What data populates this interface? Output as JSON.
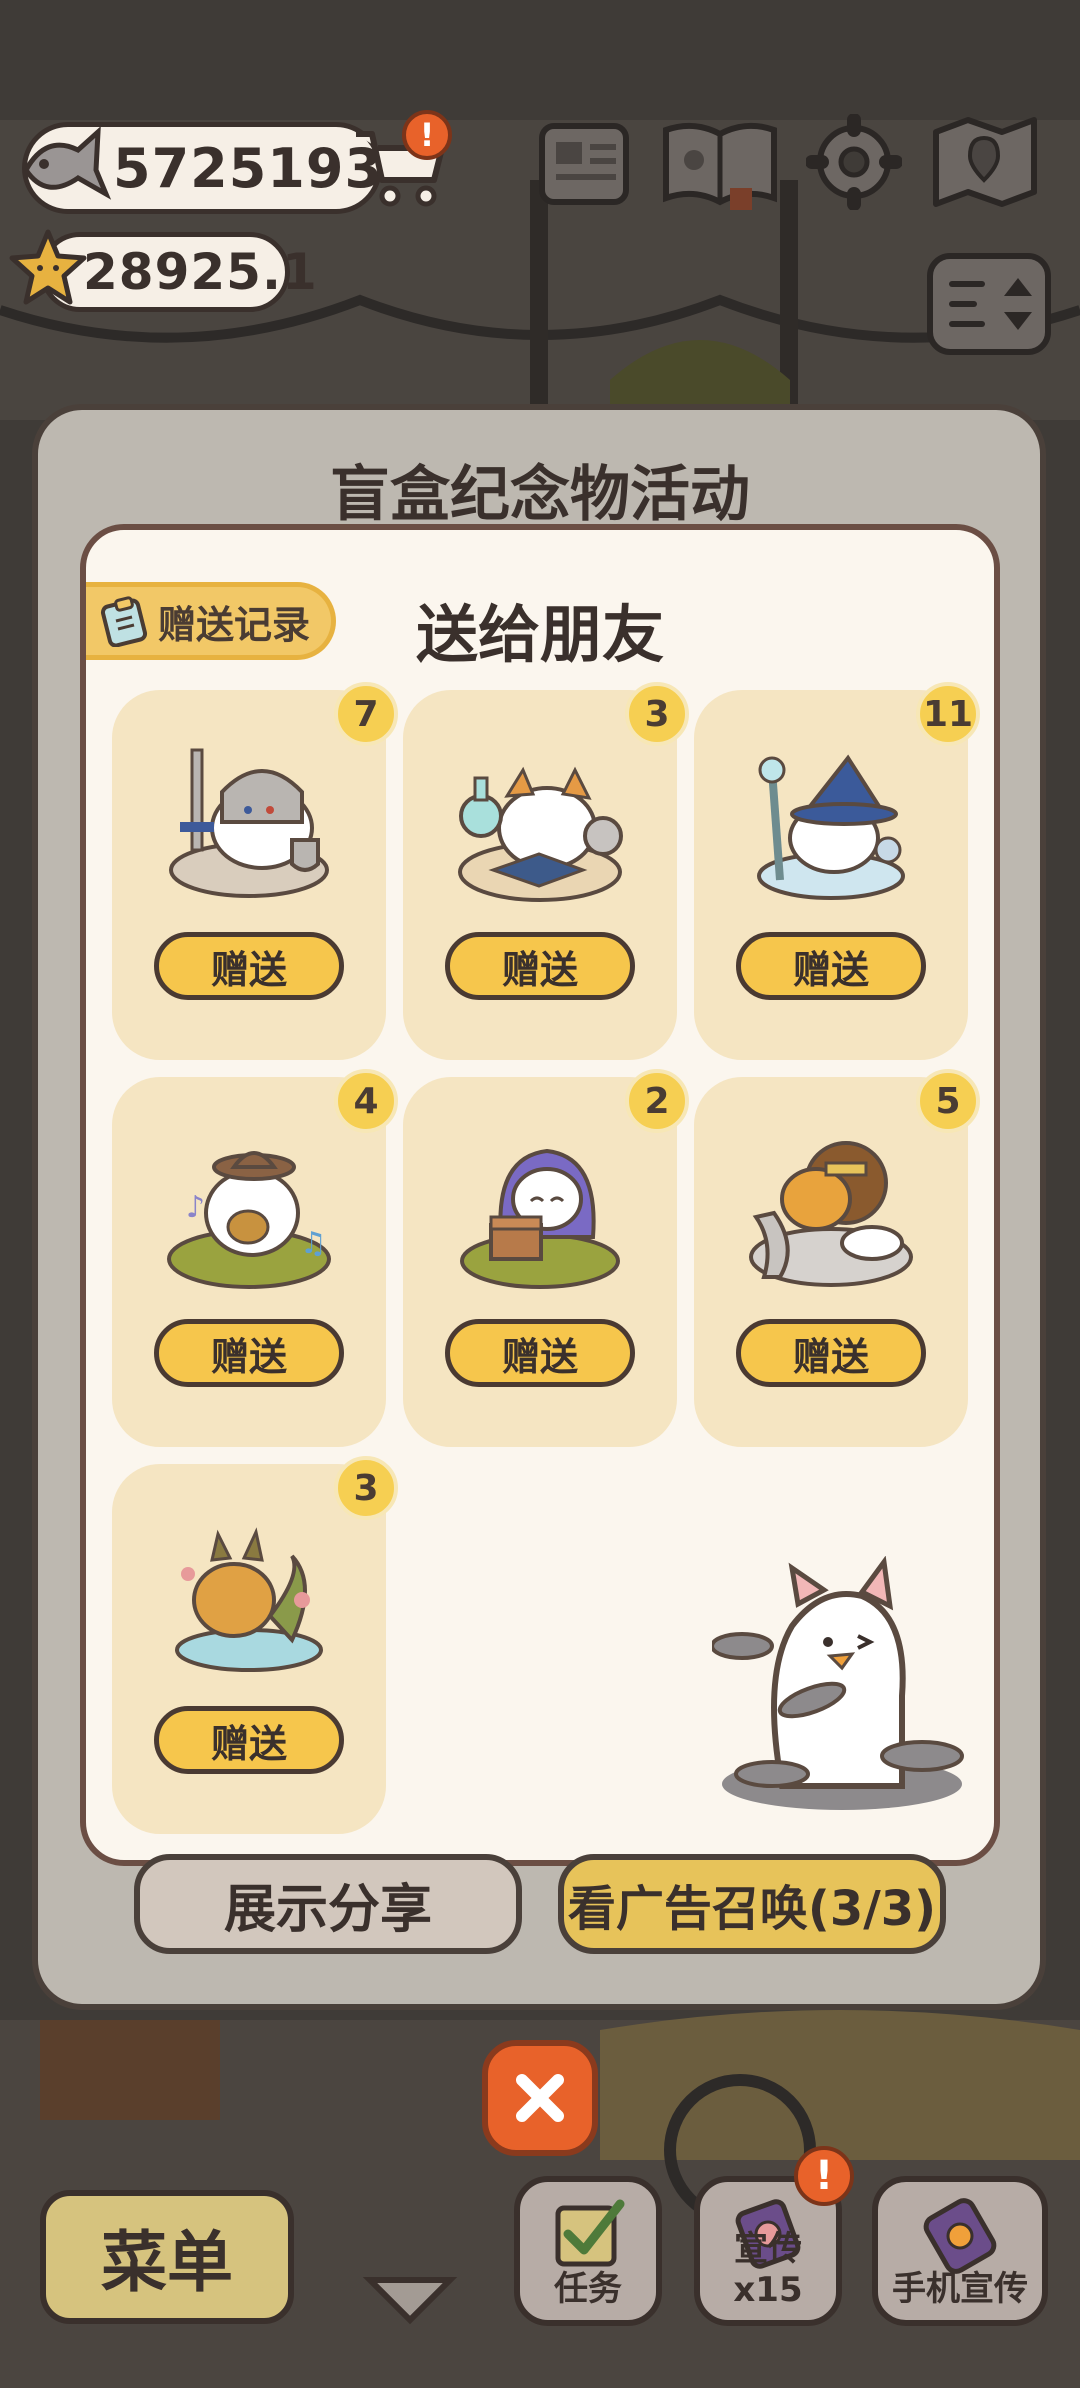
{
  "hud": {
    "fish_amount": "5725193",
    "star_amount": "28925.1",
    "cart_alert": "!"
  },
  "modal": {
    "event_title": "盲盒纪念物活动",
    "panel_title": "送给朋友",
    "history_label": "赠送记录",
    "gift_button_label": "赠送",
    "items": [
      {
        "count": "7",
        "art": "knight-cat-icon"
      },
      {
        "count": "3",
        "art": "alchemist-cat-icon"
      },
      {
        "count": "11",
        "art": "wizard-cat-icon"
      },
      {
        "count": "4",
        "art": "bard-cat-icon"
      },
      {
        "count": "2",
        "art": "rogue-cat-icon"
      },
      {
        "count": "5",
        "art": "lion-cat-icon"
      },
      {
        "count": "3",
        "art": "dragon-cat-icon"
      }
    ],
    "share_label": "展示分享",
    "ad_summon_label": "看广告召唤(3/3)"
  },
  "bottom_bar": {
    "menu_label": "菜单",
    "tasks_label": "任务",
    "promote_label": "宣传x15",
    "promote_alert": "!",
    "phone_promote_label": "手机宣传"
  },
  "colors": {
    "accent_yellow": "#f6c64c",
    "badge_yellow": "#f6cf52",
    "card_bg": "#f5e5c2",
    "panel_bg": "#fbf6ee",
    "close_orange": "#e8622a"
  }
}
